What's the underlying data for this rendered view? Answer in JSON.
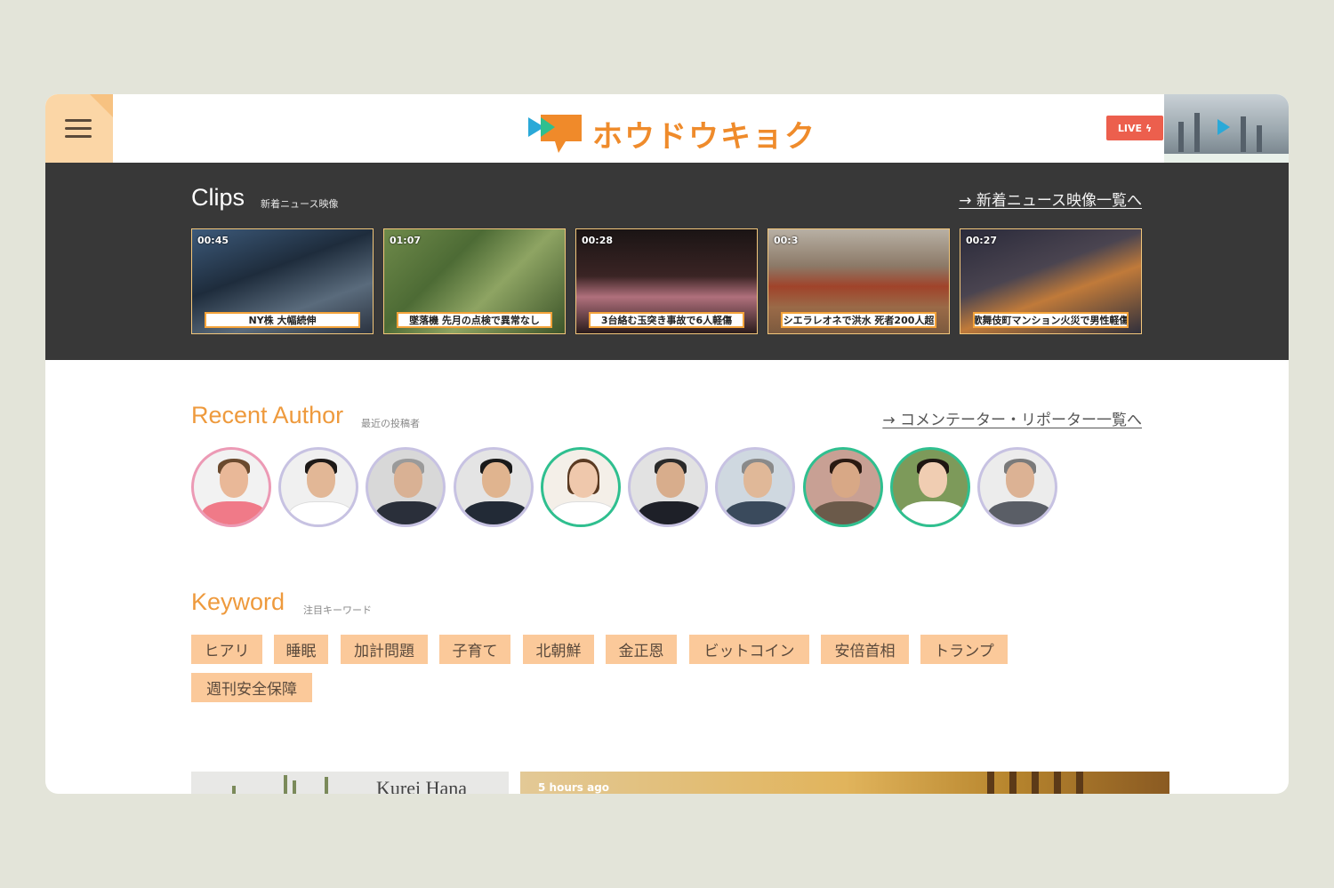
{
  "header": {
    "logo_text": "ホウドウキョク",
    "live_label": "LIVE ϟ"
  },
  "clips": {
    "title": "Clips",
    "subtitle": "新着ニュース映像",
    "link": "→ 新着ニュース映像一覧へ",
    "items": [
      {
        "duration": "00:45",
        "caption": "NY株 大幅続伸"
      },
      {
        "duration": "01:07",
        "caption": "墜落機 先月の点検で異常なし"
      },
      {
        "duration": "00:28",
        "caption": "3台絡む玉突き事故で6人軽傷"
      },
      {
        "duration": "00:3",
        "caption": "シエラレオネで洪水 死者200人超"
      },
      {
        "duration": "00:27",
        "caption": "歌舞伎町マンション火災で男性軽傷"
      }
    ]
  },
  "authors": {
    "title": "Recent Author",
    "subtitle": "最近の投稿者",
    "link": "→ コメンテーター・リポーター一覧へ"
  },
  "keywords": {
    "title": "Keyword",
    "subtitle": "注目キーワード",
    "items": [
      "ヒアリ",
      "睡眠",
      "加計問題",
      "子育て",
      "北朝鮮",
      "金正恩",
      "ビットコイン",
      "安倍首相",
      "トランプ",
      "週刊安全保障"
    ]
  },
  "bottom": {
    "brand_text": "Kurei Hana",
    "time_label": "5 hours ago"
  },
  "colors": {
    "accent_orange": "#ee9a3d",
    "keyword_bg": "#fbc99a",
    "clips_bg": "#383838",
    "live_red": "#ec5f4d",
    "avatar_ring_default": "#c7c2e2",
    "avatar_ring_green": "#2fbf8f",
    "avatar_ring_pink": "#ec9ab5"
  }
}
